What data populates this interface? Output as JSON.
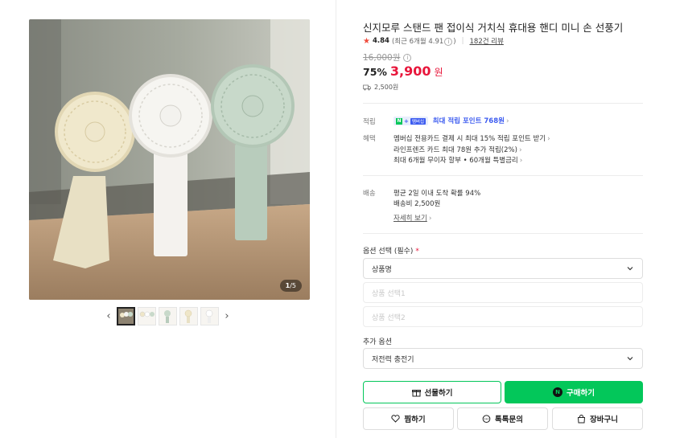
{
  "gallery": {
    "page_current": "1",
    "page_total": "/5",
    "thumb_count": 5
  },
  "product": {
    "title": "신지모루 스탠드 팬 접이식 거치식 휴대용 핸디 미니 손 선풍기",
    "rating": "4.84",
    "rating_recent": "(최근 6개월 4.91",
    "rating_recent_close": ")",
    "review_count": "182건 리뷰",
    "original_price": "16,000원",
    "discount": "75%",
    "sale_price": "3,900",
    "currency": "원",
    "shipping_fee": "2,500원"
  },
  "benefits": {
    "point_label": "적립",
    "badge_n": "N",
    "badge_plus": "+",
    "badge_member": "멤버십",
    "point_text": "최대 적립 포인트 768원",
    "benefit_label": "혜택",
    "benefit_lines": [
      "멤버십 전용카드 결제 시 최대 15% 적립 포인트 받기",
      "라인프렌즈 카드 최대 78원 추가 적립(2%)",
      "최대 6개월 무이자 할부 • 60개월 특별금리"
    ]
  },
  "delivery": {
    "label": "배송",
    "line1": "평균 2일 이내 도착 확률 94%",
    "line2": "배송비 2,500원",
    "detail_link": "자세히 보기"
  },
  "options": {
    "required_title": "옵션 선택 (필수)",
    "required_mark": "*",
    "select1": "상품명",
    "select2": "상품 선택1",
    "select3": "상품 선택2",
    "extra_title": "추가 옵션",
    "extra_select": "저전력 충전기"
  },
  "actions": {
    "gift": "선물하기",
    "buy": "구매하기",
    "buy_icon": "N",
    "wish": "찜하기",
    "talk": "톡톡문의",
    "cart": "장바구니"
  },
  "colors": {
    "accent_green": "#03c75a",
    "price_red": "#e8163b",
    "point_blue": "#3d5cf0"
  }
}
